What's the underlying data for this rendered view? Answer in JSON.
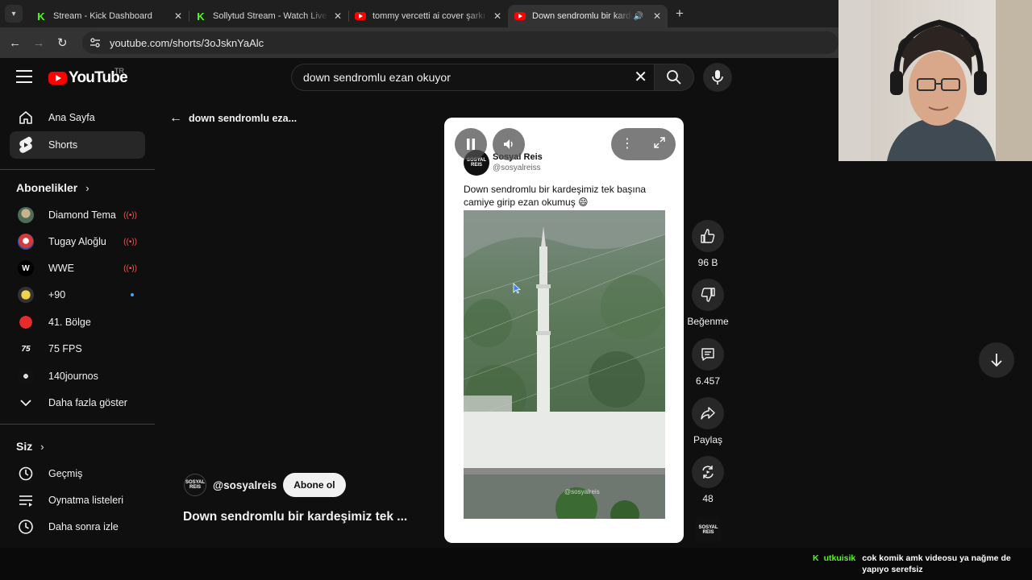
{
  "browser": {
    "tabs": [
      {
        "title": "Stream - Kick Dashboard",
        "favicon": "kick-icon",
        "active": false
      },
      {
        "title": "Sollytud Stream - Watch Live on Kick",
        "favicon": "kick-icon",
        "active": false
      },
      {
        "title": "tommy vercetti ai cover şarkı - YouTube",
        "favicon": "youtube-icon",
        "active": false
      },
      {
        "title": "Down sendromlu bir kardeşimiz",
        "favicon": "youtube-icon",
        "active": true,
        "audio": true
      }
    ],
    "url": "youtube.com/shorts/3oJsknYaAlc"
  },
  "youtube": {
    "logo_text": "YouTube",
    "country_code": "TR",
    "search_value": "down sendromlu ezan okuyor"
  },
  "sidebar": {
    "main": [
      {
        "label": "Ana Sayfa",
        "icon": "home-icon"
      },
      {
        "label": "Shorts",
        "icon": "shorts-icon",
        "active": true
      }
    ],
    "subscriptions_title": "Abonelikler",
    "subscriptions": [
      {
        "label": "Diamond Tema",
        "status": "live"
      },
      {
        "label": "Tugay Aloğlu",
        "status": "live"
      },
      {
        "label": "WWE",
        "status": "live"
      },
      {
        "label": "+90",
        "status": "new"
      },
      {
        "label": "41. Bölge",
        "status": ""
      },
      {
        "label": "75 FPS",
        "status": ""
      },
      {
        "label": "140journos",
        "status": ""
      }
    ],
    "show_more": "Daha fazla göster",
    "you_title": "Siz",
    "you": [
      {
        "label": "Geçmiş",
        "icon": "history-icon"
      },
      {
        "label": "Oynatma listeleri",
        "icon": "playlist-icon"
      },
      {
        "label": "Daha sonra izle",
        "icon": "clock-icon"
      }
    ]
  },
  "short": {
    "back_title": "down sendromlu eza...",
    "channel_handle": "@sosyalreis",
    "subscribe_label": "Abone ol",
    "title": "Down sendromlu bir kardeşimiz tek ...",
    "post": {
      "name": "Sosyal Reis",
      "handle": "@sosyalreiss",
      "text": "Down sendromlu bir kardeşimiz tek başına camiye girip ezan okumuş 😄",
      "watermark": "@sosyalreis"
    },
    "actions": {
      "likes": "96 B",
      "dislike_label": "Beğenme",
      "comments": "6.457",
      "share_label": "Paylaş",
      "remix": "48"
    },
    "logo_text": "SOSYAL REIS"
  },
  "chat": {
    "platform_badge": "K",
    "username": "utkuisik",
    "message": "cok komik amk videosu ya nağme de yapıyo serefsiz"
  },
  "colors": {
    "background": "#0f0f0f",
    "youtube_red": "#ff0000",
    "kick_green": "#53fc18",
    "live_red": "#ff4e45"
  }
}
